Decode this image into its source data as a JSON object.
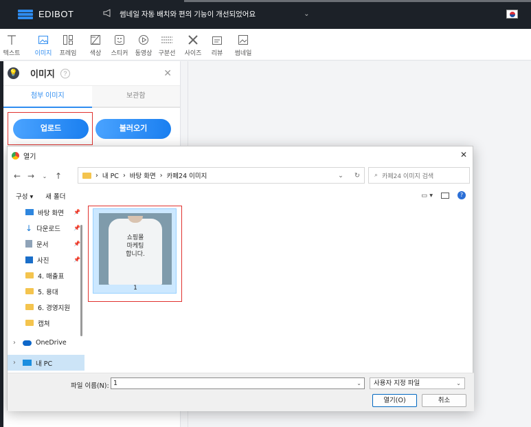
{
  "app": {
    "brand": "EDIBOT",
    "notice": "썸네일 자동 배치와 편의 기능이 개선되었어요"
  },
  "toolbar": {
    "items": [
      {
        "label": "텍스트",
        "icon": "text-icon"
      },
      {
        "label": "이미지",
        "icon": "image-icon",
        "active": true
      },
      {
        "label": "프레임",
        "icon": "frame-icon"
      },
      {
        "label": "색상",
        "icon": "color-icon"
      },
      {
        "label": "스티커",
        "icon": "sticker-icon"
      },
      {
        "label": "동영상",
        "icon": "video-icon"
      },
      {
        "label": "구분선",
        "icon": "divider-icon"
      },
      {
        "label": "사이즈",
        "icon": "size-icon"
      },
      {
        "label": "리뷰",
        "icon": "review-icon"
      },
      {
        "label": "썸네일",
        "icon": "thumbnail-icon"
      }
    ]
  },
  "panel": {
    "title": "이미지",
    "tabs": [
      "첨부 이미지",
      "보관함"
    ],
    "upload_label": "업로드",
    "load_label": "불러오기"
  },
  "dialog": {
    "title": "열기",
    "breadcrumb": [
      "내 PC",
      "바탕 화면",
      "카페24 이미지"
    ],
    "search_placeholder": "카페24 이미지 검색",
    "organize_label": "구성 ▾",
    "new_folder_label": "새 폴더",
    "tree": [
      {
        "label": "바탕 화면",
        "icon": "desktop-icon",
        "pinned": true
      },
      {
        "label": "다운로드",
        "icon": "download-icon",
        "pinned": true
      },
      {
        "label": "문서",
        "icon": "document-icon",
        "pinned": true
      },
      {
        "label": "사진",
        "icon": "pictures-icon",
        "pinned": true
      },
      {
        "label": "4. 매출표",
        "icon": "folder-icon"
      },
      {
        "label": "5. 용대",
        "icon": "folder-icon"
      },
      {
        "label": "6. 경영지원",
        "icon": "folder-icon"
      },
      {
        "label": "캡쳐",
        "icon": "folder-icon"
      },
      {
        "label": "OneDrive",
        "icon": "cloud-icon",
        "expandable": true
      },
      {
        "label": "내 PC",
        "icon": "pc-icon",
        "expandable": true,
        "selected": true
      }
    ],
    "file": {
      "name": "1",
      "thumb_text": [
        "쇼핑몰",
        "마케팅",
        "합니다."
      ]
    },
    "filename_label": "파일 이름(N):",
    "filename_value": "1",
    "filetype": "사용자 지정 파일",
    "open_label": "열기(O)",
    "cancel_label": "취소"
  }
}
